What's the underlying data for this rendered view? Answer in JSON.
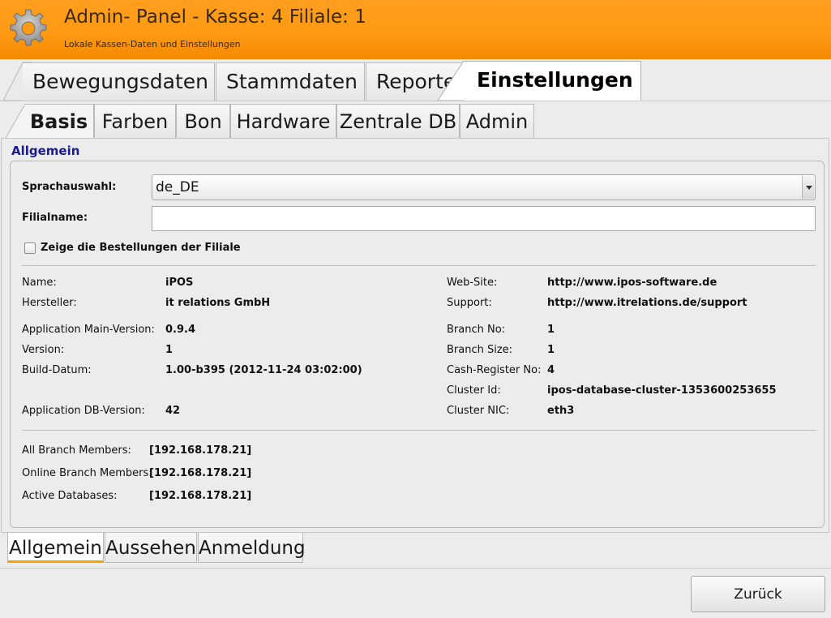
{
  "header": {
    "title": "Admin- Panel - Kasse: 4 Filiale: 1",
    "subtitle": "Lokale Kassen-Daten und Einstellungen",
    "icon": "gear-icon",
    "colors": {
      "top": "#ff9f1f",
      "bottom": "#f58a00"
    }
  },
  "main_tabs": [
    {
      "label": "Bewegungsdaten"
    },
    {
      "label": "Stammdaten"
    },
    {
      "label": "Reporte"
    },
    {
      "label": "Einstellungen",
      "active": true
    }
  ],
  "sub_tabs": [
    {
      "label": "Basis",
      "active": true
    },
    {
      "label": "Farben"
    },
    {
      "label": "Bon"
    },
    {
      "label": "Hardware"
    },
    {
      "label": "Zentrale DB"
    },
    {
      "label": "Admin"
    }
  ],
  "general": {
    "group_title": "Allgemein",
    "language_label": "Sprachauswahl:",
    "language_value": "de_DE",
    "branch_name_label": "Filialname:",
    "branch_name_value": "",
    "show_orders_label": "Zeige die Bestellungen der Filiale",
    "show_orders_checked": false
  },
  "info_left": [
    {
      "label": "Name:",
      "value": "iPOS"
    },
    {
      "label": "Hersteller:",
      "value": "it relations GmbH"
    },
    {
      "label": "Application Main-Version:",
      "value": "0.9.4"
    },
    {
      "label": "Version:",
      "value": "1"
    },
    {
      "label": "Build-Datum:",
      "value": "1.00-b395 (2012-11-24 03:02:00)"
    },
    {
      "label": "Application DB-Version:",
      "value": "42"
    }
  ],
  "info_right": [
    {
      "label": "Web-Site:",
      "value": "http://www.ipos-software.de"
    },
    {
      "label": "Support:",
      "value": "http://www.itrelations.de/support"
    },
    {
      "label": "Branch No:",
      "value": "1"
    },
    {
      "label": "Branch Size:",
      "value": "1"
    },
    {
      "label": "Cash-Register No:",
      "value": "4"
    },
    {
      "label": "Cluster Id:",
      "value": "ipos-database-cluster-1353600253655"
    },
    {
      "label": "Cluster NIC:",
      "value": "eth3"
    }
  ],
  "cluster": [
    {
      "label": "All Branch Members:",
      "value": "[192.168.178.21]"
    },
    {
      "label": "Online Branch Members:",
      "value": "[192.168.178.21]"
    },
    {
      "label": "Active Databases:",
      "value": "[192.168.178.21]"
    }
  ],
  "bottom_tabs": [
    {
      "label": "Allgemein",
      "active": true
    },
    {
      "label": "Aussehen"
    },
    {
      "label": "Anmeldung"
    }
  ],
  "footer": {
    "back_label": "Zurück"
  },
  "accent_color": "#f0a500"
}
